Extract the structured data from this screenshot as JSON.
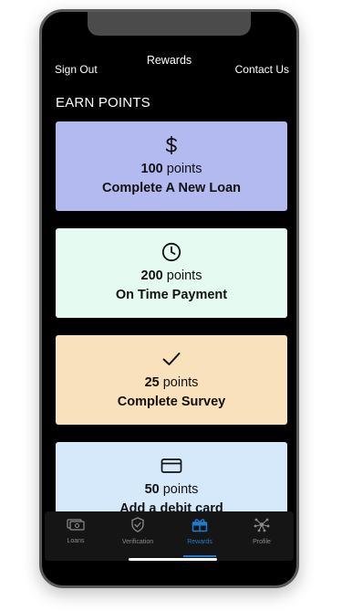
{
  "header": {
    "left_label": "Sign Out",
    "title": "Rewards",
    "right_label": "Contact Us"
  },
  "section_title": "EARN POINTS",
  "cards": [
    {
      "icon": "dollar-icon",
      "points": "100",
      "points_suffix": " points",
      "task": "Complete A New Loan",
      "color": "#b3baf0"
    },
    {
      "icon": "clock-icon",
      "points": "200",
      "points_suffix": " points",
      "task": "On Time Payment",
      "color": "#e5faf1"
    },
    {
      "icon": "checkmark-icon",
      "points": "25",
      "points_suffix": " points",
      "task": "Complete Survey",
      "color": "#f9e1bb"
    },
    {
      "icon": "credit-card-icon",
      "points": "50",
      "points_suffix": " points",
      "task": "Add a debit card",
      "color": "#d5e9fb"
    }
  ],
  "tabbar": {
    "items": [
      {
        "icon": "loans-icon",
        "label": "Loans",
        "active": false
      },
      {
        "icon": "shield-check-icon",
        "label": "Verification",
        "active": false
      },
      {
        "icon": "gift-icon",
        "label": "Rewards",
        "active": true
      },
      {
        "icon": "network-icon",
        "label": "Profile",
        "active": false
      }
    ],
    "active_color": "#1e7dd0",
    "inactive_color": "#8a8a8a"
  }
}
